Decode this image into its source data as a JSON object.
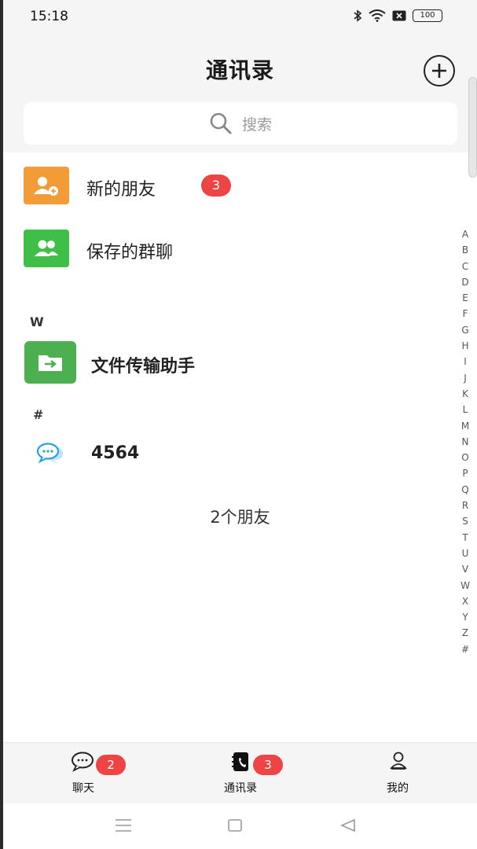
{
  "status_bar": {
    "time": "15:18",
    "battery": "100"
  },
  "header": {
    "title": "通讯录"
  },
  "search": {
    "placeholder": "搜索"
  },
  "fixed_entries": [
    {
      "label": "新的朋友",
      "badge": "3",
      "icon": "add-friend-icon",
      "color": "#f29c38"
    },
    {
      "label": "保存的群聊",
      "icon": "group-icon",
      "color": "#3fbf47"
    }
  ],
  "sections": [
    {
      "letter": "W",
      "contacts": [
        {
          "name": "文件传输助手",
          "icon": "file-transfer-icon",
          "color": "#4caf50"
        }
      ]
    },
    {
      "letter": "#",
      "contacts": [
        {
          "name": "4564",
          "icon": "chat-bubble-icon",
          "color": "#2a9fe0"
        }
      ]
    }
  ],
  "friend_count": "2个朋友",
  "alphabet": [
    "A",
    "B",
    "C",
    "D",
    "E",
    "F",
    "G",
    "H",
    "I",
    "J",
    "K",
    "L",
    "M",
    "N",
    "O",
    "P",
    "Q",
    "R",
    "S",
    "T",
    "U",
    "V",
    "W",
    "X",
    "Y",
    "Z",
    "#"
  ],
  "bottom_nav": [
    {
      "label": "聊天",
      "badge": "2",
      "icon": "chat-icon"
    },
    {
      "label": "通讯录",
      "badge": "3",
      "icon": "contacts-book-icon"
    },
    {
      "label": "我的",
      "icon": "profile-icon"
    }
  ]
}
